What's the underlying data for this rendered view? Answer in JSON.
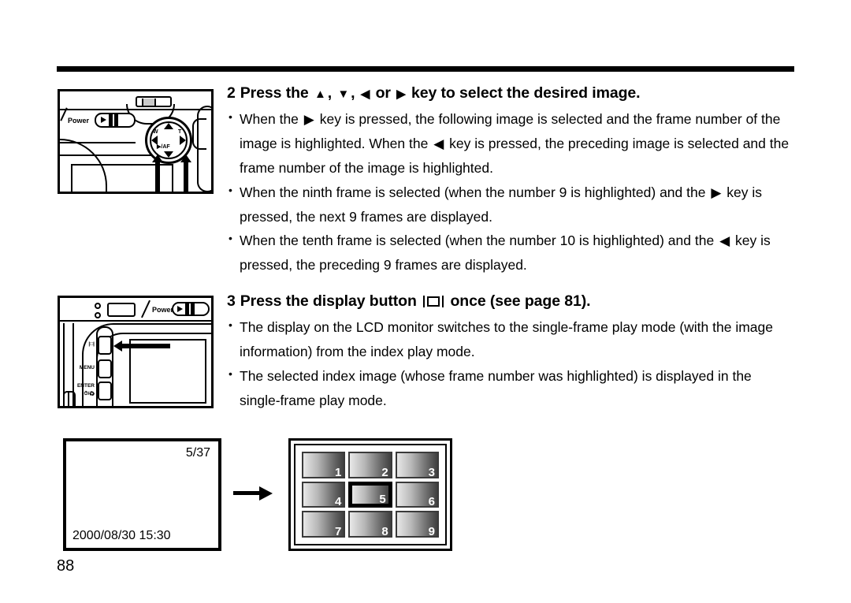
{
  "page": {
    "number": "88"
  },
  "steps": [
    {
      "number": "2",
      "heading_before": "Press the",
      "heading_mid1": ",",
      "heading_mid2": ",",
      "heading_or": "or",
      "heading_after": "key to select the desired image.",
      "bullets": [
        "key is pressed, the following image is selected and the frame number of the image is highlighted. When the",
        "key is pressed, the preceding image is selected and the frame number of the image is highlighted.",
        "When the ninth frame is selected (when the number 9 is highlighted) and the",
        "key is pressed, the next 9 frames are displayed.",
        "When the tenth frame is selected (when the number 10 is highlighted) and",
        "key is pressed, the preceding 9 frames are displayed."
      ],
      "bullet1_lead": "When the",
      "bullet3_lead": "the"
    },
    {
      "number": "3",
      "heading_before": "Press the display button",
      "heading_after": "once (see page 81).",
      "bullets": [
        "The display on the LCD monitor switches to the single-frame play mode (with the image information) from the index play mode.",
        "The selected index image (whose frame number was highlighted) is displayed in the single-frame play mode."
      ]
    }
  ],
  "glyphs": {
    "up": "▲",
    "down": "▼",
    "left": "◀",
    "right": "▶"
  },
  "camera_top": {
    "power_label": "Power",
    "pad_w": "W",
    "pad_flash": "⚡/≈",
    "pad_t": "T",
    "pad_af": "▶/AF"
  },
  "camera_back": {
    "power_label": "Power",
    "button_display": "|□|",
    "button_menu": "MENU",
    "button_enter": "ENTER",
    "button_enter_sub": "⏱/♻"
  },
  "lcd_single": {
    "frame_counter": "5/37",
    "datetime": "2000/08/30 15:30"
  },
  "lcd_index": {
    "thumbnails": [
      {
        "number": "1",
        "selected": false
      },
      {
        "number": "2",
        "selected": false
      },
      {
        "number": "3",
        "selected": false
      },
      {
        "number": "4",
        "selected": false
      },
      {
        "number": "5",
        "selected": true
      },
      {
        "number": "6",
        "selected": false
      },
      {
        "number": "7",
        "selected": false
      },
      {
        "number": "8",
        "selected": false
      },
      {
        "number": "9",
        "selected": false
      }
    ]
  }
}
